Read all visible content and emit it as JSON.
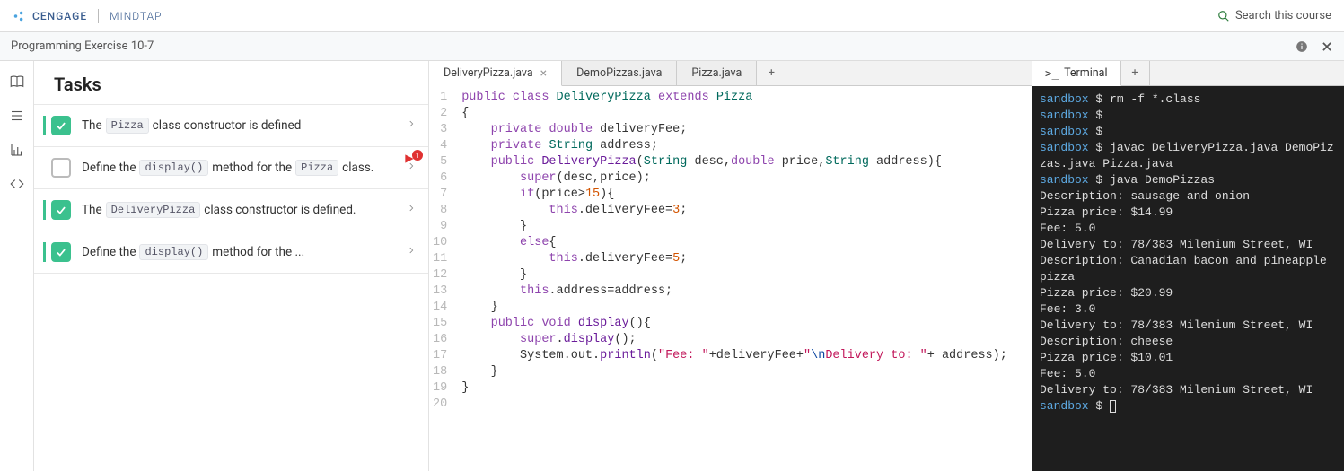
{
  "brand": {
    "cengage": "CENGAGE",
    "mindtap": "MINDTAP"
  },
  "search": {
    "placeholder": "Search this course"
  },
  "breadcrumb": "Programming Exercise 10-7",
  "tasks": {
    "heading": "Tasks",
    "items": [
      {
        "done": true,
        "parts": [
          "The ",
          {
            "code": "Pizza"
          },
          " class constructor is defined"
        ],
        "badge": false
      },
      {
        "done": false,
        "parts": [
          "Define the ",
          {
            "code": "display()"
          },
          " method for the ",
          {
            "code": "Pizza"
          },
          " class."
        ],
        "badge": true,
        "badge_count": "1"
      },
      {
        "done": true,
        "parts": [
          "The ",
          {
            "code": "DeliveryPizza"
          },
          " class constructor is defined."
        ],
        "badge": false
      },
      {
        "done": true,
        "parts": [
          "Define the ",
          {
            "code": "display()"
          },
          " method for the ..."
        ],
        "badge": false
      }
    ]
  },
  "editor": {
    "tabs": [
      {
        "label": "DeliveryPizza.java",
        "active": true
      },
      {
        "label": "DemoPizzas.java",
        "active": false
      },
      {
        "label": "Pizza.java",
        "active": false
      }
    ],
    "code_lines": [
      [
        {
          "t": "public",
          "c": "kw"
        },
        {
          "t": " "
        },
        {
          "t": "class",
          "c": "kw"
        },
        {
          "t": " "
        },
        {
          "t": "DeliveryPizza",
          "c": "typename"
        },
        {
          "t": " "
        },
        {
          "t": "extends",
          "c": "kw"
        },
        {
          "t": " "
        },
        {
          "t": "Pizza",
          "c": "typename"
        }
      ],
      [
        {
          "t": "{"
        }
      ],
      [
        {
          "t": "    "
        },
        {
          "t": "private",
          "c": "kw"
        },
        {
          "t": " "
        },
        {
          "t": "double",
          "c": "kw"
        },
        {
          "t": " deliveryFee;"
        }
      ],
      [
        {
          "t": "    "
        },
        {
          "t": "private",
          "c": "kw"
        },
        {
          "t": " "
        },
        {
          "t": "String",
          "c": "typename"
        },
        {
          "t": " address;"
        }
      ],
      [
        {
          "t": "    "
        },
        {
          "t": "public",
          "c": "kw"
        },
        {
          "t": " "
        },
        {
          "t": "DeliveryPizza",
          "c": "fn"
        },
        {
          "t": "("
        },
        {
          "t": "String",
          "c": "typename"
        },
        {
          "t": " desc,"
        },
        {
          "t": "double",
          "c": "kw"
        },
        {
          "t": " price,"
        },
        {
          "t": "String",
          "c": "typename"
        },
        {
          "t": " address){"
        }
      ],
      [
        {
          "t": "        "
        },
        {
          "t": "super",
          "c": "kw"
        },
        {
          "t": "(desc,price);"
        }
      ],
      [
        {
          "t": "        "
        },
        {
          "t": "if",
          "c": "kw"
        },
        {
          "t": "(price"
        },
        {
          "t": ">",
          "c": "op"
        },
        {
          "t": "15",
          "c": "num"
        },
        {
          "t": "){"
        }
      ],
      [
        {
          "t": "            "
        },
        {
          "t": "this",
          "c": "kw"
        },
        {
          "t": ".deliveryFee="
        },
        {
          "t": "3",
          "c": "num"
        },
        {
          "t": ";"
        }
      ],
      [
        {
          "t": "        }"
        }
      ],
      [
        {
          "t": "        "
        },
        {
          "t": "else",
          "c": "kw"
        },
        {
          "t": "{"
        }
      ],
      [
        {
          "t": "            "
        },
        {
          "t": "this",
          "c": "kw"
        },
        {
          "t": ".deliveryFee="
        },
        {
          "t": "5",
          "c": "num"
        },
        {
          "t": ";"
        }
      ],
      [
        {
          "t": "        }"
        }
      ],
      [
        {
          "t": "        "
        },
        {
          "t": "this",
          "c": "kw"
        },
        {
          "t": ".address=address;"
        }
      ],
      [
        {
          "t": "    }"
        }
      ],
      [
        {
          "t": "    "
        },
        {
          "t": "public",
          "c": "kw"
        },
        {
          "t": " "
        },
        {
          "t": "void",
          "c": "kw"
        },
        {
          "t": " "
        },
        {
          "t": "display",
          "c": "fn"
        },
        {
          "t": "(){"
        }
      ],
      [
        {
          "t": "        "
        },
        {
          "t": "super",
          "c": "kw"
        },
        {
          "t": "."
        },
        {
          "t": "display",
          "c": "fn"
        },
        {
          "t": "();"
        }
      ],
      [
        {
          "t": "        System.out."
        },
        {
          "t": "println",
          "c": "fn"
        },
        {
          "t": "("
        },
        {
          "t": "\"Fee: \"",
          "c": "str"
        },
        {
          "t": "+deliveryFee+"
        },
        {
          "t": "\"",
          "c": "str"
        },
        {
          "t": "\\n",
          "c": "esc"
        },
        {
          "t": "Delivery to: \"",
          "c": "str"
        },
        {
          "t": "+ address);"
        }
      ],
      [
        {
          "t": "    }"
        }
      ],
      [
        {
          "t": "}"
        }
      ],
      [
        {
          "t": ""
        }
      ]
    ]
  },
  "terminal": {
    "tab_label": "Terminal",
    "lines": [
      [
        {
          "t": "sandbox",
          "c": "prompt"
        },
        {
          "t": " $ rm -f *.class"
        }
      ],
      [
        {
          "t": "sandbox",
          "c": "prompt"
        },
        {
          "t": " $ "
        }
      ],
      [
        {
          "t": "sandbox",
          "c": "prompt"
        },
        {
          "t": " $ "
        }
      ],
      [
        {
          "t": "sandbox",
          "c": "prompt"
        },
        {
          "t": " $ javac DeliveryPizza.java DemoPizzas.java Pizza.java"
        }
      ],
      [
        {
          "t": "sandbox",
          "c": "prompt"
        },
        {
          "t": " $ java DemoPizzas"
        }
      ],
      [
        {
          "t": "Description: sausage and onion"
        }
      ],
      [
        {
          "t": "Pizza price: $14.99"
        }
      ],
      [
        {
          "t": "Fee: 5.0"
        }
      ],
      [
        {
          "t": "Delivery to: 78/383 Milenium Street, WI"
        }
      ],
      [
        {
          "t": "Description: Canadian bacon and pineapple pizza"
        }
      ],
      [
        {
          "t": "Pizza price: $20.99"
        }
      ],
      [
        {
          "t": "Fee: 3.0"
        }
      ],
      [
        {
          "t": "Delivery to: 78/383 Milenium Street, WI"
        }
      ],
      [
        {
          "t": "Description: cheese"
        }
      ],
      [
        {
          "t": "Pizza price: $10.01"
        }
      ],
      [
        {
          "t": "Fee: 5.0"
        }
      ],
      [
        {
          "t": "Delivery to: 78/383 Milenium Street, WI"
        }
      ],
      [
        {
          "t": "sandbox",
          "c": "prompt"
        },
        {
          "t": " $ "
        },
        {
          "cursor": true
        }
      ]
    ]
  }
}
